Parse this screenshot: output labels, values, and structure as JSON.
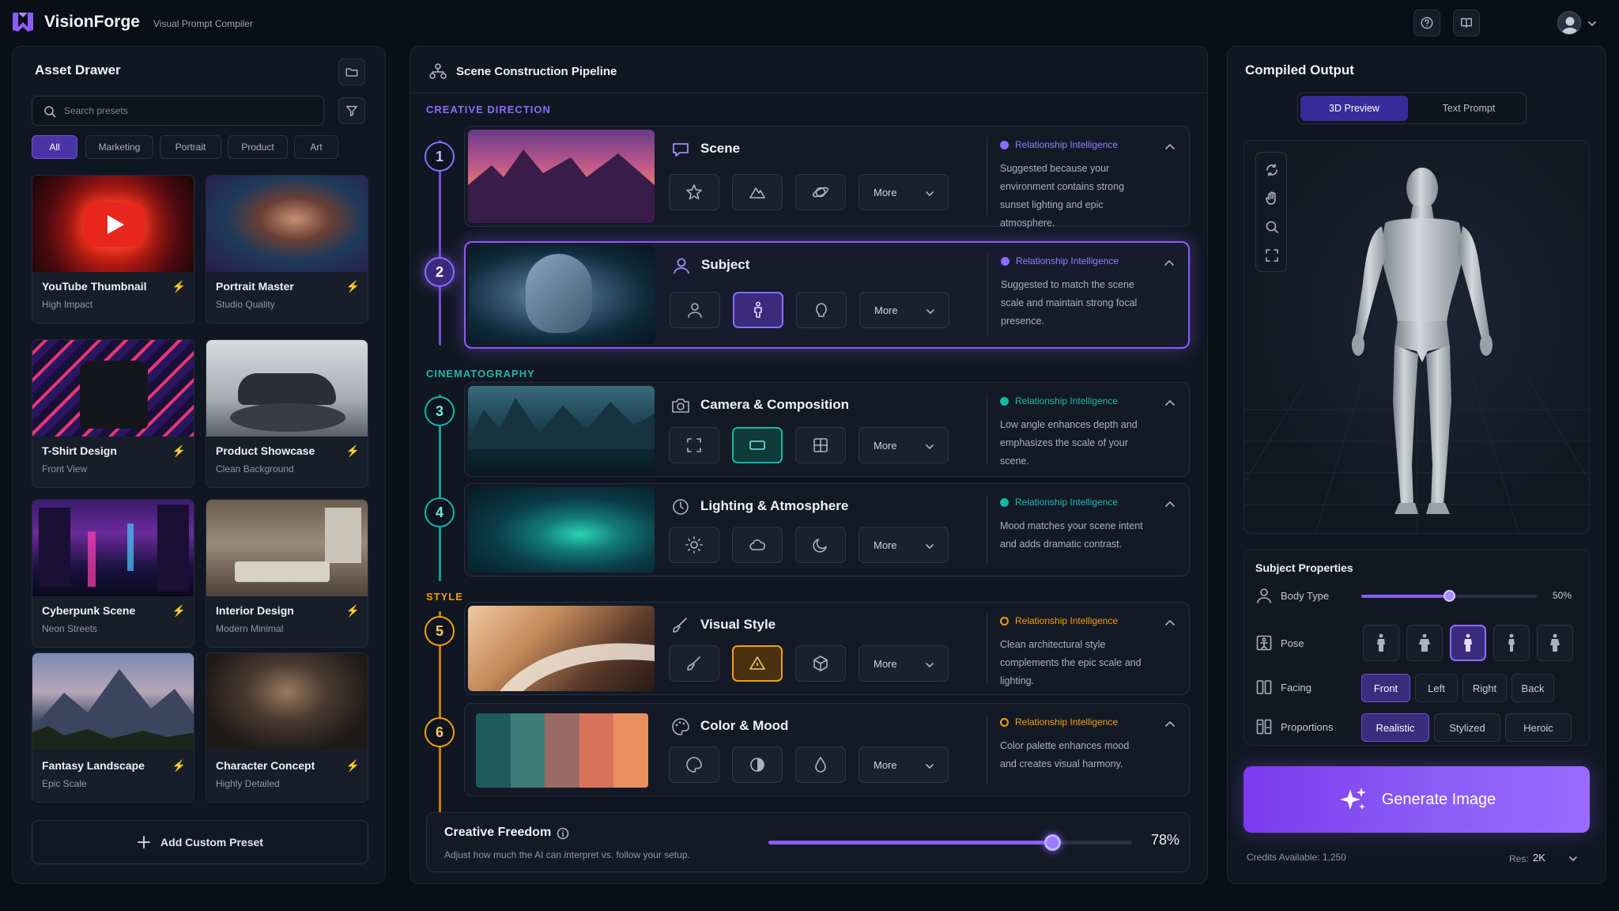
{
  "header": {
    "brand": "VisionForge",
    "subtitle": "Visual Prompt Compiler"
  },
  "drawer": {
    "title": "Asset Drawer",
    "search_placeholder": "Search presets",
    "filters": [
      "All",
      "Marketing",
      "Portrait",
      "Product",
      "Art"
    ],
    "cards": [
      {
        "title": "YouTube Thumbnail",
        "sub": "High Impact"
      },
      {
        "title": "Portrait Master",
        "sub": "Studio Quality"
      },
      {
        "title": "T-Shirt Design",
        "sub": "Front View"
      },
      {
        "title": "Product Showcase",
        "sub": "Clean Background"
      },
      {
        "title": "Cyberpunk Scene",
        "sub": "Neon Streets"
      },
      {
        "title": "Interior Design",
        "sub": "Modern Minimal"
      },
      {
        "title": "Fantasy Landscape",
        "sub": "Epic Scale"
      },
      {
        "title": "Character Concept",
        "sub": "Highly Detailed"
      }
    ],
    "add_label": "Add Custom Preset"
  },
  "pipeline": {
    "title": "Scene Construction Pipeline",
    "sections": {
      "creative": "CREATIVE DIRECTION",
      "cinema": "CINEMATOGRAPHY",
      "style": "STYLE"
    },
    "more_label": "More",
    "rel_label": "Relationship Intelligence",
    "rows": [
      {
        "num": "1",
        "title": "Scene",
        "note": "Suggested because your environment contains strong sunset lighting and epic atmosphere."
      },
      {
        "num": "2",
        "title": "Subject",
        "note": "Suggested to match the scene scale and maintain strong focal presence."
      },
      {
        "num": "3",
        "title": "Camera & Composition",
        "note": "Low angle enhances depth and emphasizes the scale of your scene."
      },
      {
        "num": "4",
        "title": "Lighting & Atmosphere",
        "note": "Mood matches your scene intent and adds dramatic contrast."
      },
      {
        "num": "5",
        "title": "Visual Style",
        "note": "Clean architectural style complements the epic scale and lighting."
      },
      {
        "num": "6",
        "title": "Color & Mood",
        "note": "Color palette enhances mood and creates visual harmony."
      }
    ],
    "freedom": {
      "title": "Creative Freedom",
      "desc": "Adjust how much the AI can interpret vs. follow your setup.",
      "value": "78%",
      "level": 0.78
    }
  },
  "output": {
    "title": "Compiled Output",
    "tabs": [
      "3D Preview",
      "Text Prompt"
    ],
    "props_title": "Subject Properties",
    "body_type": {
      "label": "Body Type",
      "value": "50%",
      "level": 0.5
    },
    "pose_label": "Pose",
    "facing": {
      "label": "Facing",
      "options": [
        "Front",
        "Left",
        "Right",
        "Back"
      ]
    },
    "proportions": {
      "label": "Proportions",
      "options": [
        "Realistic",
        "Stylized",
        "Heroic"
      ]
    },
    "generate": "Generate Image",
    "credits": "Credits Available: 1,250",
    "res_label": "Res:",
    "res_value": "2K"
  },
  "colors": {
    "accent": "#8b5cf6",
    "teal": "#14b8a6",
    "orange": "#f59e0b",
    "bg": "#0a0e16"
  }
}
